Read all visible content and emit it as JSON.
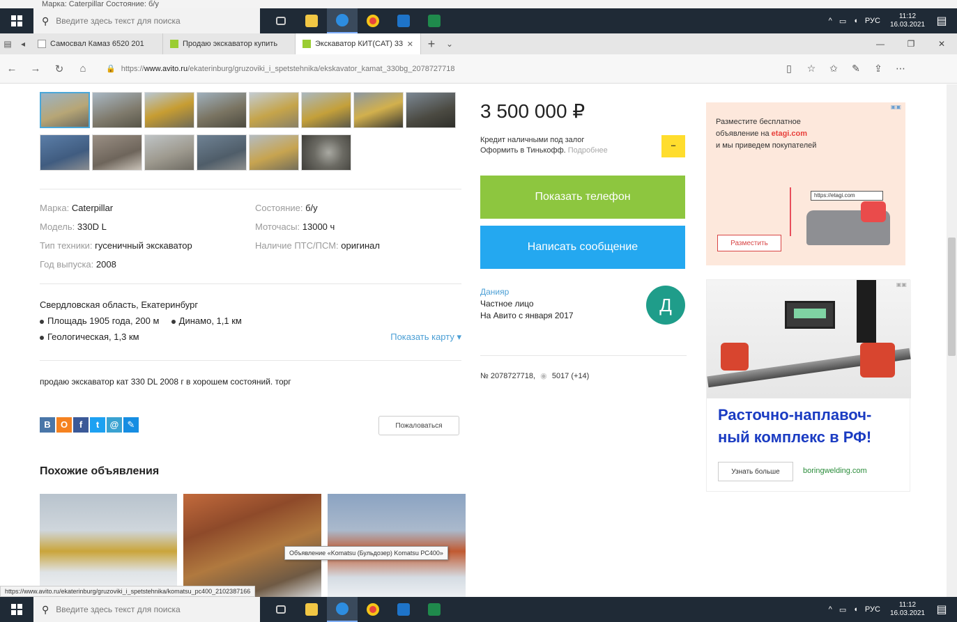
{
  "top_strip": {
    "text": "Марка: Caterpillar                                       Состояние: б/у"
  },
  "taskbar": {
    "search_placeholder": "Введите здесь текст для поиска",
    "tray": {
      "lang": "РУС",
      "time": "11:12",
      "date": "16.03.2021"
    }
  },
  "browser": {
    "tabs": [
      {
        "label": "Самосвал Камаз 6520 201"
      },
      {
        "label": "Продаю экскаватор купить"
      },
      {
        "label": "Экскаватор КИТ(CAT) 33"
      }
    ],
    "url_prefix": "https://",
    "url_domain": "www.avito.ru",
    "url_path": "/ekaterinburg/gruzoviki_i_spetstehnika/ekskavator_kamat_330bg_2078727718"
  },
  "gallery": {
    "row1": [
      "photo-1",
      "photo-2",
      "photo-3",
      "photo-4",
      "photo-5",
      "photo-6",
      "photo-7",
      "photo-8"
    ],
    "row2": [
      "photo-9",
      "photo-10",
      "photo-11",
      "photo-12",
      "photo-13",
      "photo-14"
    ]
  },
  "params": {
    "left": [
      {
        "k": "Марка:",
        "v": "Caterpillar"
      },
      {
        "k": "Модель:",
        "v": "330D L"
      },
      {
        "k": "Тип техники:",
        "v": "гусеничный экскаватор"
      },
      {
        "k": "Год выпуска:",
        "v": "2008"
      }
    ],
    "right": [
      {
        "k": "Состояние:",
        "v": "б/у"
      },
      {
        "k": "Моточасы:",
        "v": "13000 ч"
      },
      {
        "k": "Наличие ПТС/ПСМ:",
        "v": "оригинал"
      }
    ]
  },
  "address": {
    "line": "Свердловская область, Екатеринбург",
    "metro1": "Площадь 1905 года, 200 м",
    "metro2": "Динамо, 1,1 км",
    "metro3": "Геологическая, 1,3 км",
    "show_map": "Показать карту ▾"
  },
  "description": "продаю экскаватор кат 330 DL 2008 г в хорошем состояний. торг",
  "share": {
    "complain": "Пожаловаться"
  },
  "similar": {
    "title": "Похожие объявления"
  },
  "tooltip": "Объявление «Komatsu (Бульдозер) Komatsu PC400»",
  "status_url": "https://www.avito.ru/ekaterinburg/gruzoviki_i_spetstehnika/komatsu_pc400_2102387166",
  "seller": {
    "price": "3 500 000 ₽",
    "credit_line1": "Кредит наличными под залог",
    "credit_line2": "Оформить в Тинькофф.",
    "credit_more": "Подробнее",
    "phone_btn": "Показать телефон",
    "msg_btn": "Написать сообщение",
    "name": "Данияр",
    "type": "Частное лицо",
    "since": "На Авито с января 2017",
    "avatar_letter": "Д",
    "ad_number": "№ 2078727718,",
    "views": "5017 (+14)"
  },
  "ads": {
    "ad1": {
      "line1": "Разместите бесплатное",
      "line2": "объявление на",
      "brand": "etagi.com",
      "line3": "и мы приведем покупателей",
      "url_label": "https://etagi.com",
      "btn": "Разместить"
    },
    "ad2": {
      "title1": "Расточно-наплавоч-",
      "title2": "ный комплекс в РФ!",
      "btn": "Узнать больше",
      "domain": "boringwelding.com"
    }
  },
  "colors": {
    "green": "#8dc63f",
    "blue": "#24a8f0",
    "avatar": "#1f9d8a",
    "link": "#4b9fd5"
  }
}
